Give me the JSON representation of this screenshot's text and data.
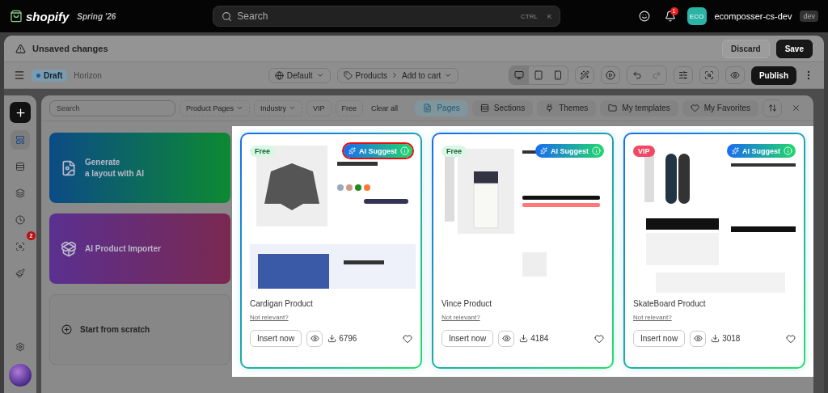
{
  "topbar": {
    "brand": "shopify",
    "version": "Spring '26",
    "search": {
      "placeholder": "Search"
    },
    "shortcut": [
      "CTRL",
      "K"
    ],
    "notification_count": "1",
    "avatar": "ECO",
    "store": "ecomposser-cs-dev",
    "env": "dev"
  },
  "unsaved_bar": {
    "title": "Unsaved changes",
    "buttons": [
      {
        "label": "Discard",
        "kind": "secondary"
      },
      {
        "label": "Save",
        "kind": "primary"
      }
    ]
  },
  "toolbar": {
    "status": "Draft",
    "theme": "Horizon",
    "locale": "Default",
    "breadcrumb": [
      "Products",
      "Add to cart"
    ],
    "devices": [
      {
        "kind": "desktop",
        "selected": true
      },
      {
        "kind": "tablet",
        "selected": false
      },
      {
        "kind": "mobile",
        "selected": false
      }
    ],
    "publish": "Publish"
  },
  "rail": [
    {
      "kind": "pages",
      "selected": true
    },
    {
      "kind": "sections",
      "selected": false
    },
    {
      "kind": "layers",
      "selected": false
    },
    {
      "kind": "history",
      "selected": false
    },
    {
      "kind": "inspect",
      "selected": false,
      "badge": "2"
    },
    {
      "kind": "brush",
      "selected": false
    },
    {
      "kind": "settings",
      "selected": false
    }
  ],
  "library": {
    "search": {
      "placeholder": "Search"
    },
    "filters": [
      {
        "label": "Product Pages",
        "dropdown": true
      },
      {
        "label": "Industry",
        "dropdown": true
      },
      {
        "label": "VIP",
        "dropdown": false
      },
      {
        "label": "Free",
        "dropdown": false
      }
    ],
    "clear": "Clear all",
    "tabs": [
      {
        "label": "Pages",
        "kind": "pages",
        "selected": true
      },
      {
        "label": "Sections",
        "kind": "sections",
        "selected": false
      },
      {
        "label": "Themes",
        "kind": "themes",
        "selected": false
      },
      {
        "label": "My templates",
        "kind": "folder",
        "selected": false
      },
      {
        "label": "My Favorites",
        "kind": "heart",
        "selected": false
      }
    ],
    "actions": [
      {
        "kind": "generate",
        "lines": [
          "Generate",
          "a layout with AI"
        ]
      },
      {
        "kind": "importer",
        "lines": [
          "AI Product Importer"
        ]
      },
      {
        "kind": "scratch",
        "lines": [
          "Start from scratch"
        ]
      }
    ],
    "templates": [
      {
        "kind": "cardigan",
        "name": "Cardigan Product",
        "tag": {
          "label": "Free",
          "kind": "free"
        },
        "ai_label": "AI Suggest",
        "highlighted": true,
        "not_relevant": "Not relevant?",
        "insert": "Insert now",
        "downloads": "6796",
        "favorite": false
      },
      {
        "kind": "pants",
        "name": "Vince Product",
        "tag": {
          "label": "Free",
          "kind": "free"
        },
        "ai_label": "AI Suggest",
        "highlighted": false,
        "not_relevant": "Not relevant?",
        "insert": "Insert now",
        "downloads": "4184",
        "favorite": false
      },
      {
        "kind": "skateboard",
        "name": "SkateBoard Product",
        "tag": {
          "label": "VIP",
          "kind": "vip"
        },
        "ai_label": "AI Suggest",
        "highlighted": false,
        "not_relevant": "Not relevant?",
        "insert": "Insert now",
        "downloads": "3018",
        "favorite": false
      }
    ]
  }
}
